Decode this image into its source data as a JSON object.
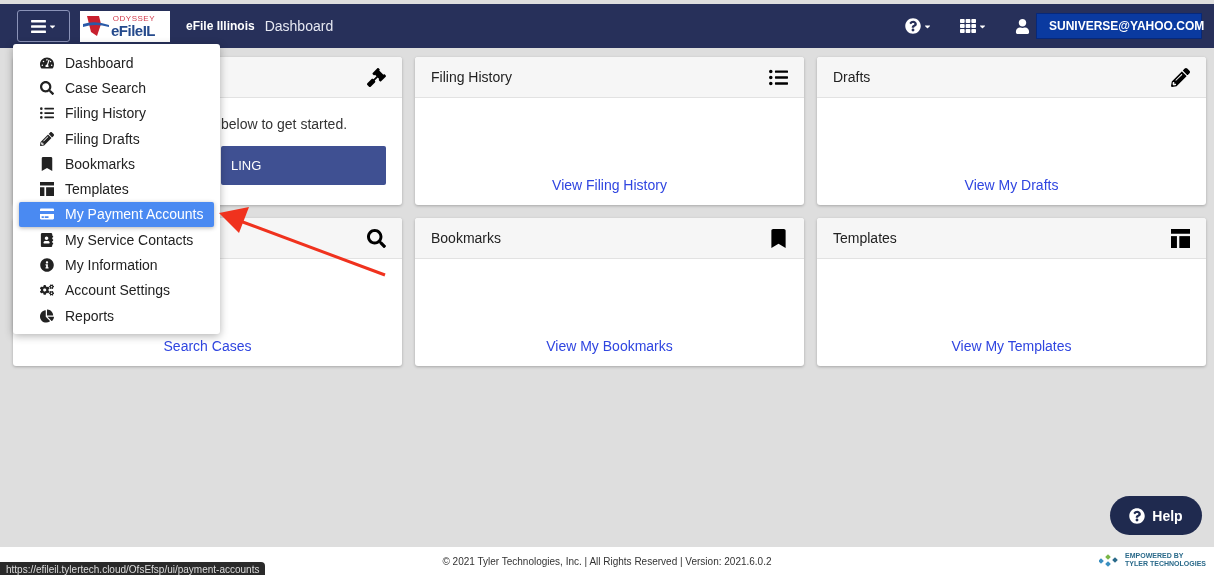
{
  "navbar": {
    "logo": {
      "top": "ODYSSEY",
      "main": "eFileIL"
    },
    "app_name": "eFile Illinois",
    "page_title": "Dashboard",
    "user": "SUNIVERSE@YAHOO.COM"
  },
  "menu": [
    {
      "label": "Dashboard",
      "kind": "gauge",
      "selected": false
    },
    {
      "label": "Case Search",
      "kind": "search",
      "selected": false
    },
    {
      "label": "Filing History",
      "kind": "list",
      "selected": false
    },
    {
      "label": "Filing Drafts",
      "kind": "pencil",
      "selected": false
    },
    {
      "label": "Bookmarks",
      "kind": "bookmark",
      "selected": false
    },
    {
      "label": "Templates",
      "kind": "template",
      "selected": false
    },
    {
      "label": "My Payment Accounts",
      "kind": "card",
      "selected": true
    },
    {
      "label": "My Service Contacts",
      "kind": "contact",
      "selected": false
    },
    {
      "label": "My Information",
      "kind": "info",
      "selected": false
    },
    {
      "label": "Account Settings",
      "kind": "gears",
      "selected": false
    },
    {
      "label": "Reports",
      "kind": "pie",
      "selected": false
    }
  ],
  "cards": [
    {
      "kind": "gavel",
      "body_text": "below to get started.",
      "button": "LING"
    },
    {
      "title": "Filing History",
      "kind": "list",
      "link": "View Filing History"
    },
    {
      "title": "Drafts",
      "kind": "pencil",
      "link": "View My Drafts"
    },
    {
      "kind": "search",
      "link": "Search Cases"
    },
    {
      "title": "Bookmarks",
      "kind": "bookmark",
      "link": "View My Bookmarks"
    },
    {
      "title": "Templates",
      "kind": "template",
      "link": "View My Templates"
    }
  ],
  "help_button": "Help",
  "status_url": "https://efileil.tylertech.cloud/OfsEfsp/ui/payment-accounts",
  "footer": "© 2021 Tyler Technologies, Inc. | All Rights Reserved | Version: 2021.6.0.2",
  "vendor_logo": {
    "line_1": "EMPOWERED BY",
    "line_2": "TYLER TECHNOLOGIES"
  }
}
